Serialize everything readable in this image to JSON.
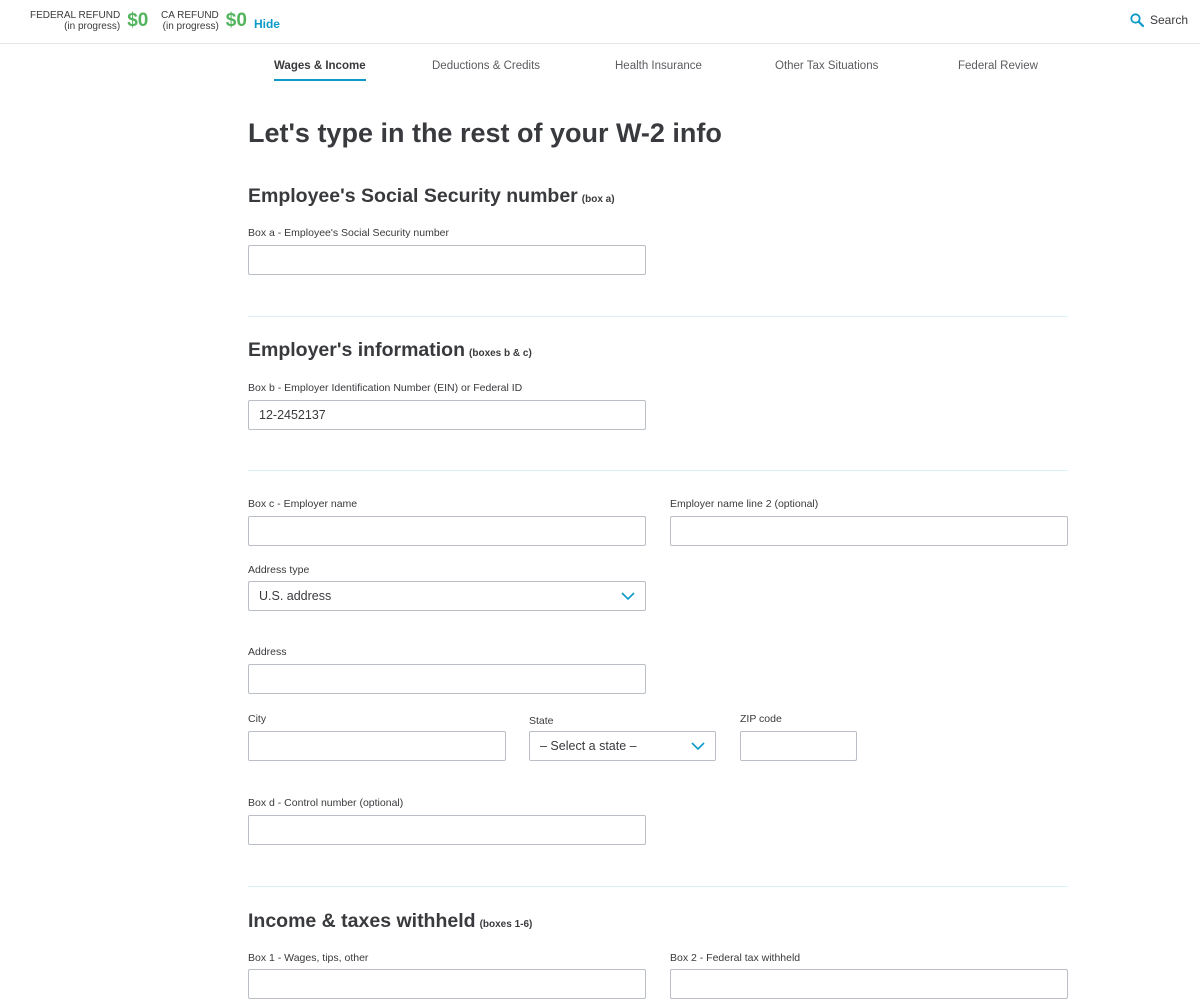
{
  "header": {
    "federal_refund": {
      "label_line1": "FEDERAL REFUND",
      "label_line2": "(in progress)",
      "amount": "$0"
    },
    "state_refund": {
      "label_line1": "CA REFUND",
      "label_line2": "(in progress)",
      "amount": "$0"
    },
    "hide_label": "Hide",
    "search_label": "Search",
    "search_icon": "search-icon"
  },
  "tabs": [
    {
      "label": "Wages & Income",
      "active": true
    },
    {
      "label": "Deductions & Credits",
      "active": false
    },
    {
      "label": "Health Insurance",
      "active": false
    },
    {
      "label": "Other Tax Situations",
      "active": false
    },
    {
      "label": "Federal Review",
      "active": false
    }
  ],
  "page": {
    "title": "Let's type in the rest of your W-2 info"
  },
  "sections": {
    "employee": {
      "title": "Employee's Social Security number",
      "sub": "(box a)",
      "ssn": {
        "label": "Box a - Employee's Social Security number",
        "value": ""
      }
    },
    "employer": {
      "title": "Employer's information",
      "sub": "(boxes b & c)",
      "ein": {
        "label": "Box b - Employer Identification Number (EIN) or Federal ID",
        "value": "12-2452137"
      },
      "name": {
        "label": "Box c - Employer name",
        "value": ""
      },
      "name2": {
        "label": "Employer name line 2 (optional)",
        "value": ""
      },
      "address_type": {
        "label": "Address type",
        "value": "U.S. address"
      },
      "address": {
        "label": "Address",
        "value": ""
      },
      "city": {
        "label": "City",
        "value": ""
      },
      "state": {
        "label": "State",
        "value": "– Select a state –"
      },
      "zip": {
        "label": "ZIP code",
        "value": ""
      },
      "control": {
        "label": "Box d - Control number (optional)",
        "value": ""
      }
    },
    "income": {
      "title": "Income & taxes withheld",
      "sub": "(boxes 1-6)",
      "box1": {
        "label": "Box 1 - Wages, tips, other",
        "value": ""
      },
      "box2": {
        "label": "Box 2 - Federal tax withheld",
        "value": ""
      }
    }
  },
  "colors": {
    "accent": "#0d9ac7",
    "refund_green": "#52b45c"
  }
}
